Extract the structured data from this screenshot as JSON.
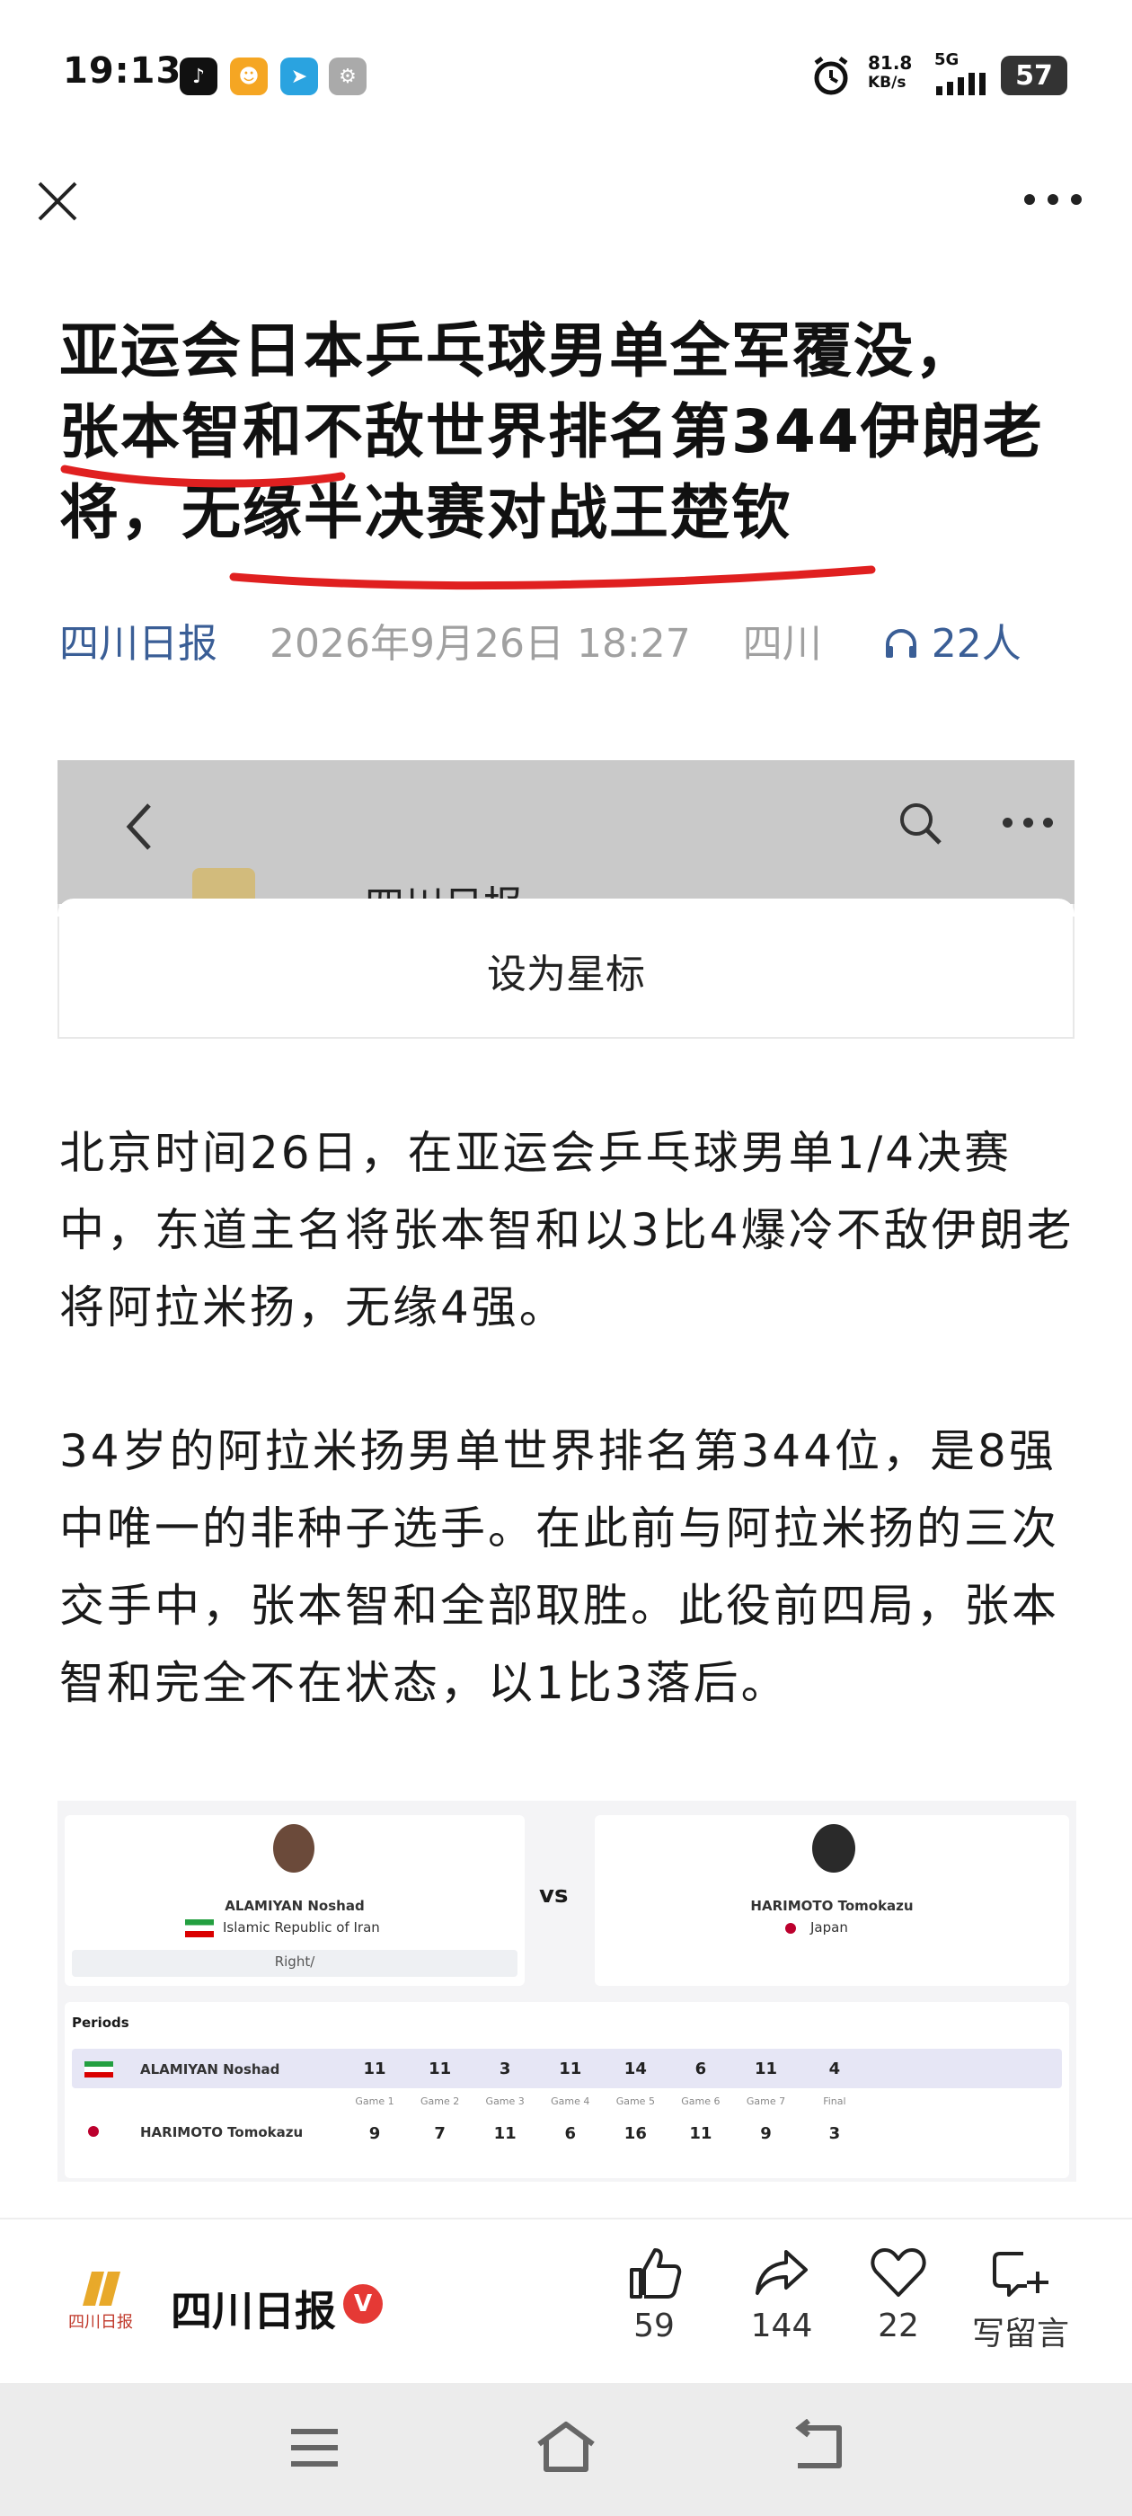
{
  "status_bar": {
    "time": "19:13",
    "net_speed_value": "81.8",
    "net_speed_unit": "KB/s",
    "network": "5G",
    "battery": "57"
  },
  "article": {
    "title_line1": "亚运会日本乒乓球男单全军覆没，",
    "title_line2": "张本智和不敌世界排名第344伊朗老",
    "title_line3": "将，无缘半决赛对战王楚钦",
    "source": "四川日报",
    "datetime": "2026年9月26日 18:27",
    "region": "四川",
    "listeners": "22人"
  },
  "embedded_card": {
    "account_name": "四川日报",
    "star_label": "设为星标"
  },
  "paragraphs": [
    "北京时间26日，在亚运会乒乓球男单1/4决赛中，东道主名将张本智和以3比4爆冷不敌伊朗老将阿拉米扬，无缘4强。",
    "34岁的阿拉米扬男单世界排名第344位，是8强中唯一的非种子选手。在此前与阿拉米扬的三次交手中，张本智和全部取胜。此役前四局，张本智和完全不在状态，以1比3落后。"
  ],
  "scoreboard": {
    "vs": "vs",
    "player1": {
      "name": "ALAMIYAN Noshad",
      "country": "Islamic Republic of Iran",
      "hand": "Right/",
      "flag_color": "#239f40"
    },
    "player2": {
      "name": "HARIMOTO Tomokazu",
      "country": "Japan",
      "flag_color": "#bc002d"
    },
    "periods_label": "Periods",
    "game_labels": [
      "Game 1",
      "Game 2",
      "Game 3",
      "Game 4",
      "Game 5",
      "Game 6",
      "Game 7",
      "Final"
    ],
    "row1_name": "ALAMIYAN Noshad",
    "row1_scores": [
      "11",
      "11",
      "3",
      "11",
      "14",
      "6",
      "11",
      "4"
    ],
    "row2_name": "HARIMOTO Tomokazu",
    "row2_scores": [
      "9",
      "7",
      "11",
      "6",
      "16",
      "11",
      "9",
      "3"
    ]
  },
  "bottom_bar": {
    "account": "四川日报",
    "verified": "V",
    "likes": "59",
    "shares": "144",
    "favorites": "22",
    "comment_label": "写留言"
  }
}
